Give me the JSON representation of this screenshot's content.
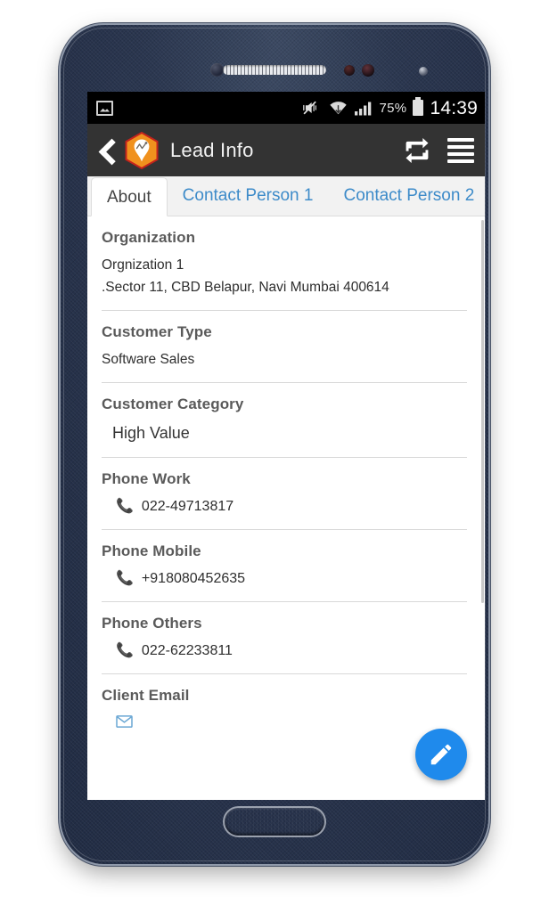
{
  "device": {
    "name": "android-smartphone",
    "body_color": "#2b3750"
  },
  "statusbar": {
    "gallery_icon": "gallery-icon",
    "vibrate_icon": "vibrate-mute-icon",
    "wifi_icon": "wifi-icon",
    "signal_icon": "cellular-signal-icon",
    "battery_percent": "75%",
    "battery_icon": "battery-icon",
    "time": "14:39"
  },
  "appbar": {
    "back_icon": "back-chevron-icon",
    "logo_icon": "app-logo-icon",
    "title": "Lead Info",
    "sync_icon": "sync-repeat-icon",
    "menu_icon": "hamburger-menu-icon",
    "bg_color": "#333333"
  },
  "tabs": [
    {
      "label": "About",
      "active": true
    },
    {
      "label": "Contact Person 1",
      "active": false
    },
    {
      "label": "Contact Person 2",
      "active": false
    }
  ],
  "accent": {
    "tab_blue": "#3d8bc9",
    "fab_blue": "#1f8aec",
    "phone_icon_blue": "#2b87c8",
    "mail_icon_blue": "#6aa7d4",
    "logo_orange": "#f0911e"
  },
  "fields": [
    {
      "label": "Organization",
      "value": "Orgnization 1",
      "value2": ".Sector 11,  CBD Belapur,  Navi Mumbai 400614"
    },
    {
      "label": "Customer Type",
      "value": "Software Sales"
    },
    {
      "label": "Customer Category",
      "value": "High Value"
    },
    {
      "label": "Phone Work",
      "value": "022-49713817",
      "icon": "phone-icon"
    },
    {
      "label": "Phone Mobile",
      "value": "+918080452635",
      "icon": "phone-icon"
    },
    {
      "label": "Phone Others",
      "value": "022-62233811",
      "icon": "phone-icon"
    },
    {
      "label": "Client Email",
      "value": "",
      "icon": "email-icon"
    }
  ],
  "fab": {
    "icon": "edit-pencil-icon",
    "label": "Edit"
  }
}
